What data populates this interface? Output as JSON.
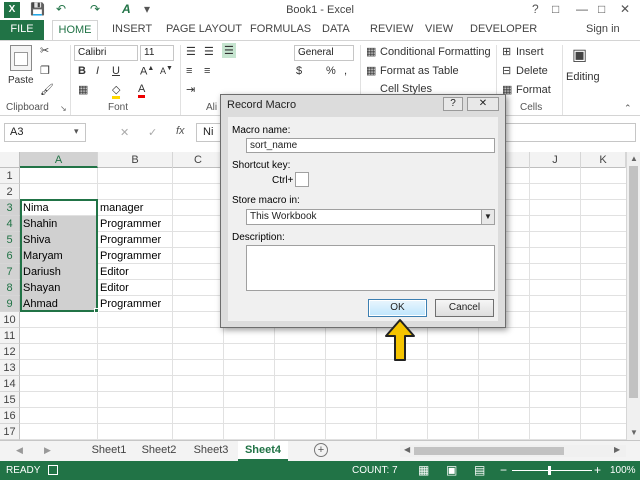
{
  "window": {
    "title": "Book1 - Excel"
  },
  "tabs": {
    "file": "FILE",
    "home": "HOME",
    "insert": "INSERT",
    "page_layout": "PAGE LAYOUT",
    "formulas": "FORMULAS",
    "data": "DATA",
    "review": "REVIEW",
    "view": "VIEW",
    "developer": "DEVELOPER",
    "sign_in": "Sign in"
  },
  "ribbon": {
    "clipboard": "Clipboard",
    "paste": "Paste",
    "font_group": "Font",
    "font_name": "Calibri",
    "font_size": "11",
    "alignment_partial": "Ali",
    "number_format": "General",
    "conditional_formatting": "Conditional Formatting",
    "format_as_table": "Format as Table",
    "cell_styles": "Cell Styles",
    "insert": "Insert",
    "delete": "Delete",
    "format": "Format",
    "cells": "Cells",
    "editing": "Editing"
  },
  "formula_bar": {
    "name_box": "A3",
    "fx": "fx",
    "partial": "Ni"
  },
  "columns": [
    "A",
    "B",
    "C",
    "D",
    "E",
    "F",
    "G",
    "H",
    "I",
    "J",
    "K"
  ],
  "rows": [
    "1",
    "2",
    "3",
    "4",
    "5",
    "6",
    "7",
    "8",
    "9",
    "10",
    "11",
    "12",
    "13",
    "14",
    "15",
    "16",
    "17"
  ],
  "cells": [
    {
      "name": "Nima",
      "role": "manager"
    },
    {
      "name": "Shahin",
      "role": "Programmer"
    },
    {
      "name": "Shiva",
      "role": "Programmer"
    },
    {
      "name": "Maryam",
      "role": "Programmer"
    },
    {
      "name": "Dariush",
      "role": "Editor"
    },
    {
      "name": "Shayan",
      "role": "Editor"
    },
    {
      "name": "Ahmad",
      "role": "Programmer"
    }
  ],
  "dialog": {
    "title": "Record Macro",
    "help": "?",
    "close": "✕",
    "macro_name_label": "Macro name:",
    "macro_name_value": "sort_name",
    "shortcut_label": "Shortcut key:",
    "ctrl_label": "Ctrl+",
    "store_label": "Store macro in:",
    "store_value": "This Workbook",
    "description_label": "Description:",
    "ok": "OK",
    "cancel": "Cancel"
  },
  "sheets": {
    "tabs": [
      "Sheet1",
      "Sheet2",
      "Sheet3",
      "Sheet4"
    ],
    "active": "Sheet4"
  },
  "status": {
    "ready": "READY",
    "count": "COUNT: 7",
    "zoom": "100%"
  },
  "colors": {
    "accent": "#217346",
    "arrow": "#f5c400"
  }
}
